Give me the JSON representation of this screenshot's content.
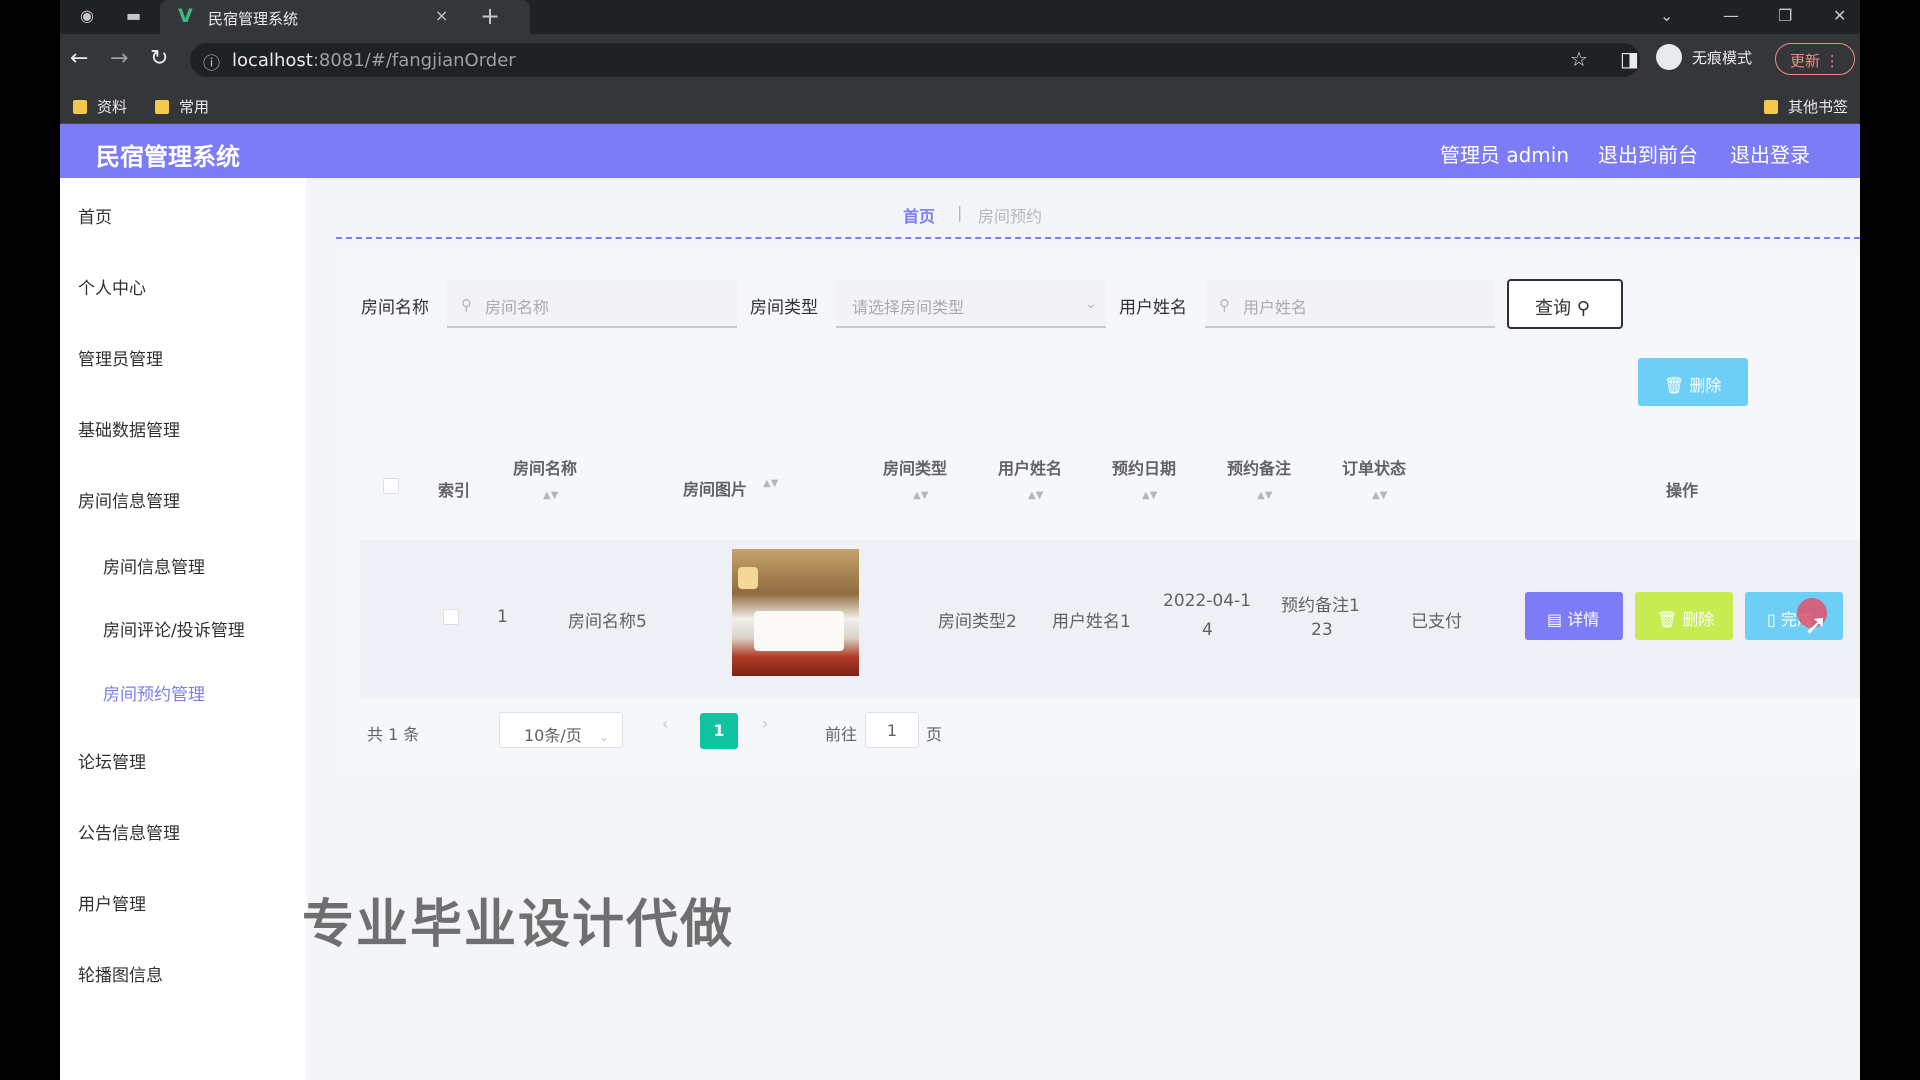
{
  "browser": {
    "tab_title": "民宿管理系统",
    "tab_close": "×",
    "new_tab": "+",
    "url_host": "localhost",
    "url_rest": ":8081/#/fangjianOrder",
    "incognito_label": "无痕模式",
    "update_label": "更新",
    "bookmarks": [
      "资料",
      "常用"
    ],
    "other_bookmarks": "其他书签"
  },
  "app": {
    "title": "民宿管理系统",
    "header_links": [
      "管理员 admin",
      "退出到前台",
      "退出登录"
    ]
  },
  "sidebar": {
    "items": [
      "首页",
      "个人中心",
      "管理员管理",
      "基础数据管理",
      "房间信息管理"
    ],
    "sub_items": [
      "房间信息管理",
      "房间评论/投诉管理",
      "房间预约管理"
    ],
    "items_after": [
      "论坛管理",
      "公告信息管理",
      "用户管理",
      "轮播图信息"
    ]
  },
  "breadcrumb": {
    "home": "首页",
    "current": "房间预约"
  },
  "search": {
    "room_name_label": "房间名称",
    "room_name_placeholder": "房间名称",
    "room_type_label": "房间类型",
    "room_type_placeholder": "请选择房间类型",
    "user_name_label": "用户姓名",
    "user_name_placeholder": "用户姓名",
    "query_button": "查询"
  },
  "toolbar": {
    "delete_button": "删除"
  },
  "table": {
    "headers": [
      "索引",
      "房间名称",
      "房间图片",
      "房间类型",
      "用户姓名",
      "预约日期",
      "预约备注",
      "订单状态",
      "操作"
    ],
    "rows": [
      {
        "index": "1",
        "room_name": "房间名称5",
        "room_type": "房间类型2",
        "user_name": "用户姓名1",
        "date_line1": "2022-04-1",
        "date_line2": "4",
        "note_line1": "预约备注1",
        "note_line2": "23",
        "status": "已支付",
        "actions": [
          "详情",
          "删除",
          "完成"
        ]
      }
    ]
  },
  "pagination": {
    "total": "共 1 条",
    "page_size": "10条/页",
    "current_page": "1",
    "goto_label": "前往",
    "goto_value": "1",
    "page_suffix": "页"
  },
  "watermark": "专业毕业设计代做",
  "colors": {
    "header": "#7b7cf6",
    "detail_button": "#7b7cf6",
    "delete_button": "#c6ec52",
    "complete_button": "#6ecff6",
    "page_active": "#13c2a0"
  }
}
